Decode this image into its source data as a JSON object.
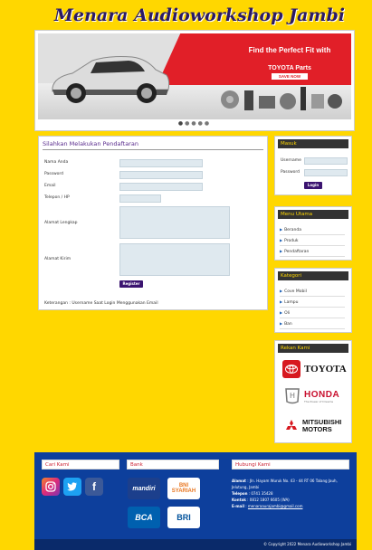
{
  "site": {
    "title": "Menara Audioworkshop Jambi"
  },
  "banner": {
    "headline": "Find the Perfect Fit with",
    "brand": "TOYOTA Parts",
    "cta": "SAVE NOW",
    "dots": 5
  },
  "registration": {
    "title": "Silahkan Melakukan Pendaftaran",
    "fields": [
      {
        "label": "Nama Anda"
      },
      {
        "label": "Password"
      },
      {
        "label": "Email"
      },
      {
        "label": "Telepon / HP"
      },
      {
        "label": "Alamat Lengkap"
      },
      {
        "label": "Alamat Kirim"
      }
    ],
    "submit_label": "Register",
    "note": "Keterangan : Username Saat Login Menggunakan Email"
  },
  "login": {
    "title": "Masuk",
    "username_label": "Username",
    "password_label": "Password",
    "button": "Login"
  },
  "menu": {
    "title": "Menu Utama",
    "items": [
      "Beranda",
      "Produk",
      "Pendaftaran"
    ]
  },
  "categories": {
    "title": "Kategori",
    "items": [
      "Cove Mobil",
      "Lampu",
      "Oli",
      "Ban"
    ]
  },
  "partners": {
    "title": "Rekan Kami",
    "logos": [
      "TOYOTA",
      "HONDA",
      "MITSUBISHI MOTORS"
    ],
    "honda_tagline": "The Power of Dreams"
  },
  "footer": {
    "social_title": "Cari Kami",
    "bank_title": "Bank",
    "contact_title": "Hubungi Kami",
    "banks": [
      "mandiri",
      "BNI SYARIAH",
      "BCA",
      "BRI"
    ],
    "contact": {
      "address_label": "Alamat",
      "address": "Jln. Hayam Wuruk No. 43 - 44 RT 06 Talang Jauh, Jelutung, Jambi",
      "phone_label": "Telepon",
      "phone": "0741 35428",
      "contact_label": "Kontak",
      "contact": "0812 1807 6605 (WA)",
      "email_label": "E-mail",
      "email": "menaraaurajambi@gmail.com"
    },
    "copyright": "© Copyright 2022 Menara Audioworkshop Jambi"
  },
  "colors": {
    "background": "#FFD700",
    "footer": "#0d3f9c",
    "accent": "#3b1470",
    "banner_red": "#e11f28"
  }
}
